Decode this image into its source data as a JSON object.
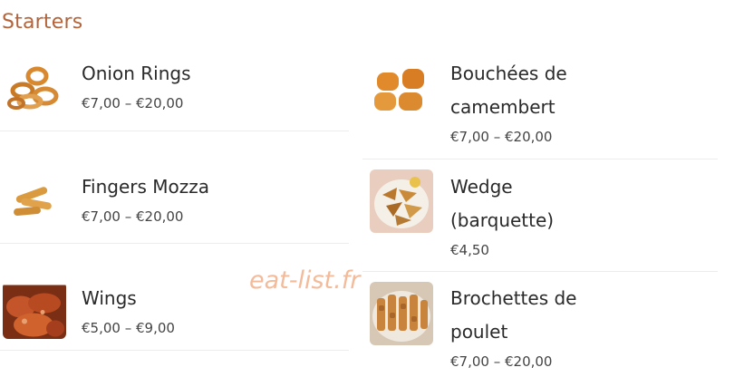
{
  "section": {
    "title": "Starters"
  },
  "items": [
    {
      "name": "Onion Rings",
      "price": "€7,00 – €20,00",
      "icon": "onion-rings-image"
    },
    {
      "name": "Bouchées de camembert",
      "name_line1": "Bouchées de",
      "name_line2": "camembert",
      "price": "€7,00 – €20,00",
      "icon": "camembert-bites-image"
    },
    {
      "name": "Fingers Mozza",
      "price": "€7,00 – €20,00",
      "icon": "mozzarella-sticks-image"
    },
    {
      "name": "Wedge (barquette)",
      "name_line1": "Wedge",
      "name_line2": "(barquette)",
      "price": "€4,50",
      "icon": "potato-wedges-image"
    },
    {
      "name": "Wings",
      "price": "€5,00 – €9,00",
      "icon": "chicken-wings-image"
    },
    {
      "name": "Brochettes de poulet",
      "name_line1": "Brochettes de",
      "name_line2": "poulet",
      "price": "€7,00 – €20,00",
      "icon": "chicken-skewers-image"
    }
  ],
  "watermark": "eat-list.fr",
  "colors": {
    "accent": "#b5643a",
    "watermark": "#f2b48f",
    "divider": "#ececec"
  }
}
